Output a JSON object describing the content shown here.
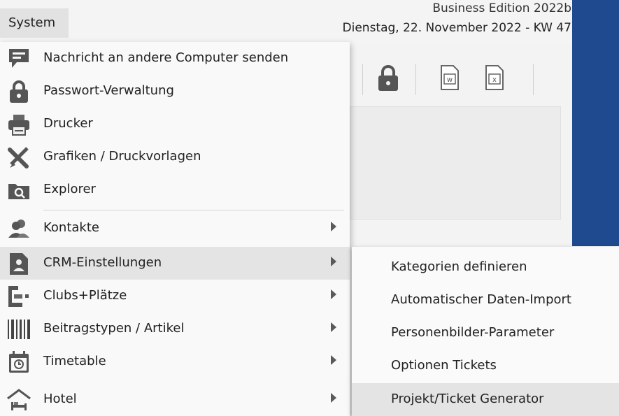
{
  "header": {
    "system_tab": "System",
    "edition": "Business Edition 2022b",
    "date": "Dienstag, 22. November 2022 - KW 47"
  },
  "main_menu": {
    "items": [
      {
        "label": "Nachricht an andere Computer senden",
        "icon": "message-icon"
      },
      {
        "label": "Passwort-Verwaltung",
        "icon": "lock-icon"
      },
      {
        "label": "Drucker",
        "icon": "printer-icon"
      },
      {
        "label": "Grafiken / Druckvorlagen",
        "icon": "tools-icon"
      },
      {
        "label": "Explorer",
        "icon": "explorer-icon"
      },
      {
        "label": "Kontakte",
        "icon": "contacts-icon",
        "submenu": true
      },
      {
        "label": "CRM-Einstellungen",
        "icon": "crm-settings-icon",
        "submenu": true,
        "highlighted": true
      },
      {
        "label": "Clubs+Plätze",
        "icon": "clubs-icon",
        "submenu": true
      },
      {
        "label": "Beitragstypen / Artikel",
        "icon": "barcode-icon",
        "submenu": true
      },
      {
        "label": "Timetable",
        "icon": "calendar-clock-icon",
        "submenu": true
      },
      {
        "label": "Hotel",
        "icon": "hotel-icon",
        "submenu": true
      }
    ]
  },
  "submenu": {
    "items": [
      {
        "label": "Kategorien definieren"
      },
      {
        "label": "Automatischer Daten-Import"
      },
      {
        "label": "Personenbilder-Parameter"
      },
      {
        "label": "Optionen Tickets"
      },
      {
        "label": "Projekt/Ticket Generator",
        "highlighted": true
      }
    ]
  },
  "toolbar": {
    "icons": [
      "lock-icon",
      "word-document-icon",
      "excel-document-icon"
    ]
  },
  "colors": {
    "menu_background": "#f9f9f9",
    "highlight": "#e4e4e4",
    "blue_panel": "#1f4a8f",
    "icon_gray": "#555555"
  }
}
